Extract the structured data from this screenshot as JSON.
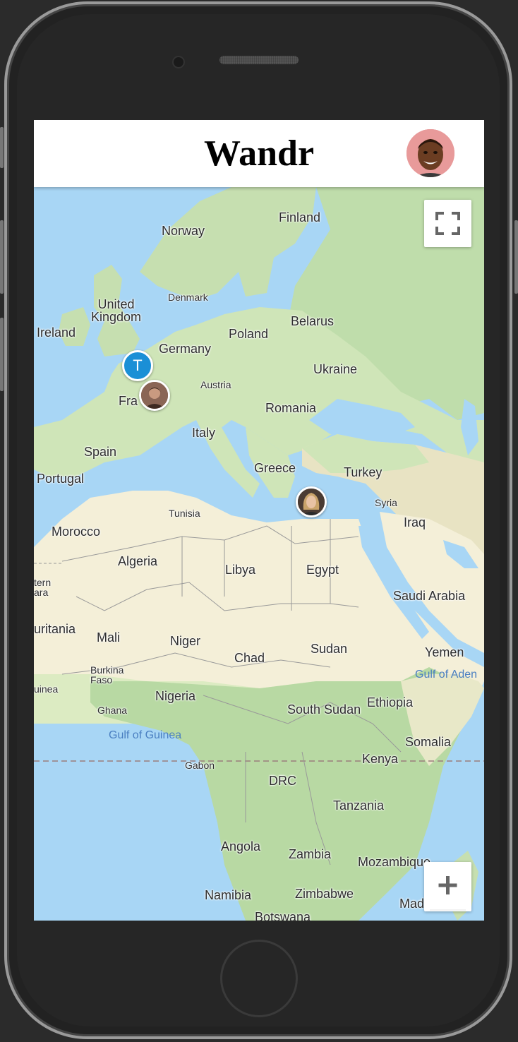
{
  "app": {
    "title": "Wandr"
  },
  "header": {
    "avatar_icon": "user-avatar"
  },
  "map": {
    "labels": {
      "finland": "Finland",
      "norway": "Norway",
      "denmark": "Denmark",
      "uk": "United\nKingdom",
      "ireland": "Ireland",
      "belarus": "Belarus",
      "poland": "Poland",
      "germany": "Germany",
      "ukraine": "Ukraine",
      "austria": "Austria",
      "france": "Fra",
      "romania": "Romania",
      "italy": "Italy",
      "spain": "Spain",
      "greece": "Greece",
      "turkey": "Turkey",
      "portugal": "Portugal",
      "syria": "Syria",
      "tunisia": "Tunisia",
      "iraq": "Iraq",
      "morocco": "Morocco",
      "algeria": "Algeria",
      "libya": "Libya",
      "egypt": "Egypt",
      "western_sahara": "tern\nara",
      "saudi_arabia": "Saudi Arabia",
      "mauritania": "uritania",
      "mali": "Mali",
      "niger": "Niger",
      "sudan": "Sudan",
      "chad": "Chad",
      "yemen": "Yemen",
      "gulf_of_aden": "Gulf of Aden",
      "burkina_faso": "Burkina\nFaso",
      "guinea": "uinea",
      "nigeria": "Nigeria",
      "ghana": "Ghana",
      "south_sudan": "South Sudan",
      "ethiopia": "Ethiopia",
      "gulf_of_guinea": "Gulf of Guinea",
      "somalia": "Somalia",
      "gabon": "Gabon",
      "kenya": "Kenya",
      "drc": "DRC",
      "tanzania": "Tanzania",
      "angola": "Angola",
      "zambia": "Zambia",
      "mozambique": "Mozambique",
      "namibia": "Namibia",
      "zimbabwe": "Zimbabwe",
      "madagascar": "Mad",
      "botswana": "Botswana"
    },
    "markers": {
      "t_marker_letter": "T"
    },
    "controls": {
      "fullscreen_icon": "fullscreen-icon",
      "zoom_in_icon": "plus-icon"
    }
  }
}
